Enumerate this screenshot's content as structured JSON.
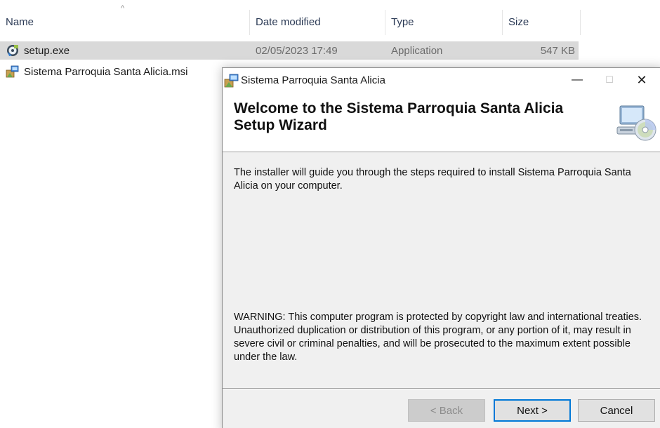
{
  "explorer": {
    "columns": {
      "name": "Name",
      "date": "Date modified",
      "type": "Type",
      "size": "Size"
    },
    "sort_indicator": "^",
    "files": [
      {
        "name": "setup.exe",
        "date": "02/05/2023 17:49",
        "type": "Application",
        "size": "547 KB",
        "icon": "setup-exe-icon",
        "selected": true
      },
      {
        "name": "Sistema Parroquia Santa Alicia.msi",
        "date": "",
        "type": "",
        "size": "",
        "icon": "msi-package-icon",
        "selected": false
      }
    ]
  },
  "dialog": {
    "title": "Sistema Parroquia Santa Alicia",
    "controls": {
      "minimize": "—",
      "maximize": "☐",
      "close": "✕"
    },
    "banner_title": "Welcome to the Sistema Parroquia Santa Alicia Setup Wizard",
    "body": "The installer will guide you through the steps required to install Sistema Parroquia Santa Alicia on your computer.",
    "warning": "WARNING: This computer program is protected by copyright law and international treaties. Unauthorized duplication or distribution of this program, or any portion of it, may result in severe civil or criminal penalties, and will be prosecuted to the maximum extent possible under the law.",
    "buttons": {
      "back": "< Back",
      "next": "Next >",
      "cancel": "Cancel"
    }
  },
  "colors": {
    "selection": "#d9d9d9",
    "accent": "#0078d7",
    "dialog_bg": "#f0f0f0"
  }
}
